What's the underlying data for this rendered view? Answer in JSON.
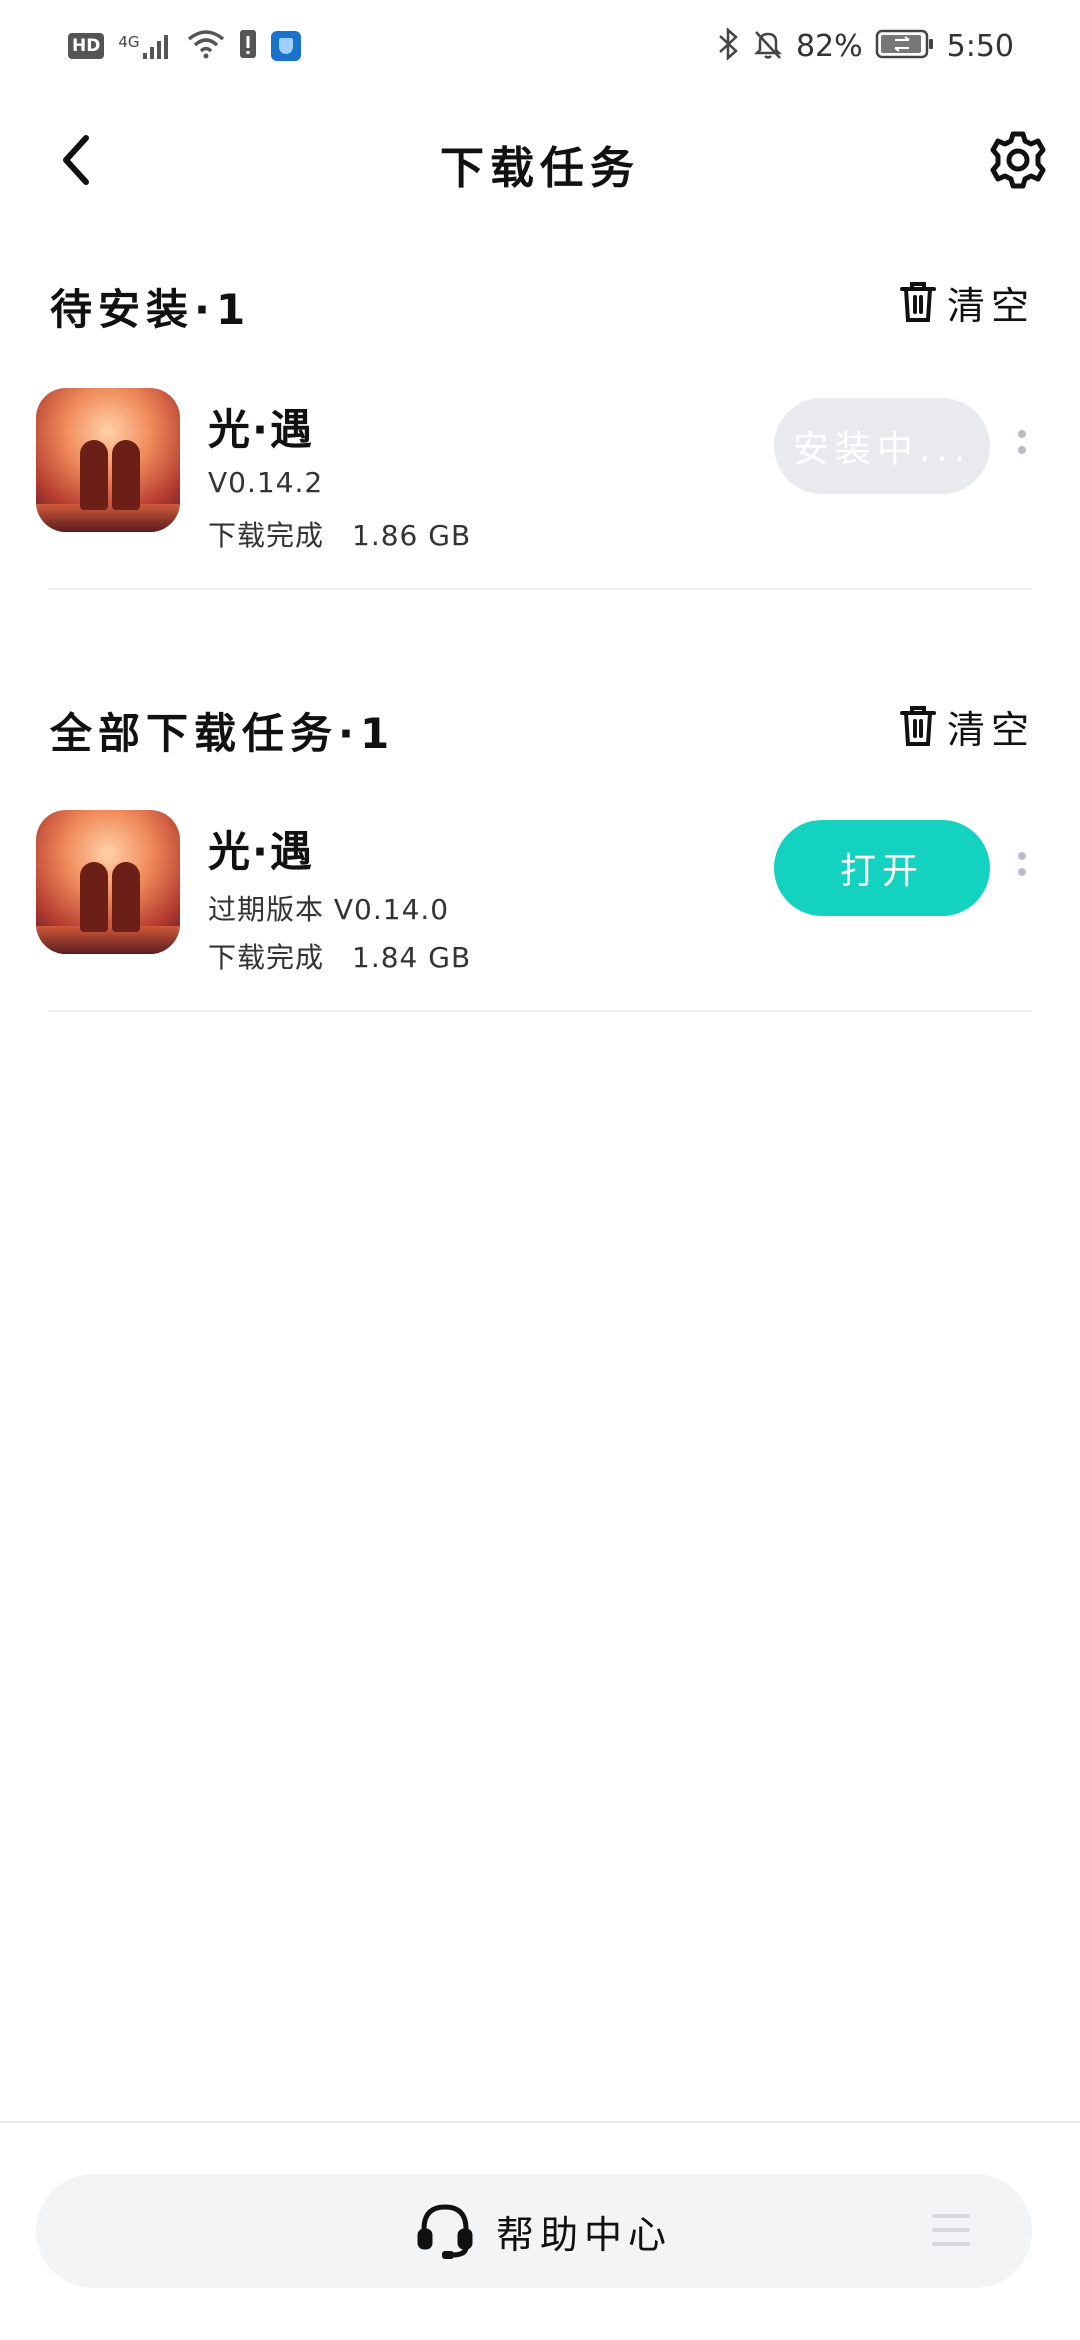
{
  "status_bar": {
    "hd": "HD",
    "network": "4G",
    "battery": "82%",
    "time": "5:50"
  },
  "header": {
    "title": "下载任务"
  },
  "pending_section": {
    "title": "待安装·1",
    "clear_label": "清空",
    "items": [
      {
        "name": "光·遇",
        "version": "V0.14.2",
        "status": "下载完成",
        "size": "1.86 GB",
        "action": "安装中..."
      }
    ]
  },
  "all_section": {
    "title": "全部下载任务·1",
    "clear_label": "清空",
    "items": [
      {
        "name": "光·遇",
        "version": "过期版本 V0.14.0",
        "status": "下载完成",
        "size": "1.84 GB",
        "action": "打开"
      }
    ]
  },
  "bottom": {
    "help_label": "帮助中心"
  },
  "colors": {
    "accent": "#14d2c0",
    "disabled_button": "#e9eaee",
    "more_dots": "#b8bcc2"
  },
  "icons": [
    "back-arrow-icon",
    "settings-gear-icon",
    "trash-icon",
    "more-vertical-icon",
    "headset-icon",
    "menu-lines-icon"
  ]
}
